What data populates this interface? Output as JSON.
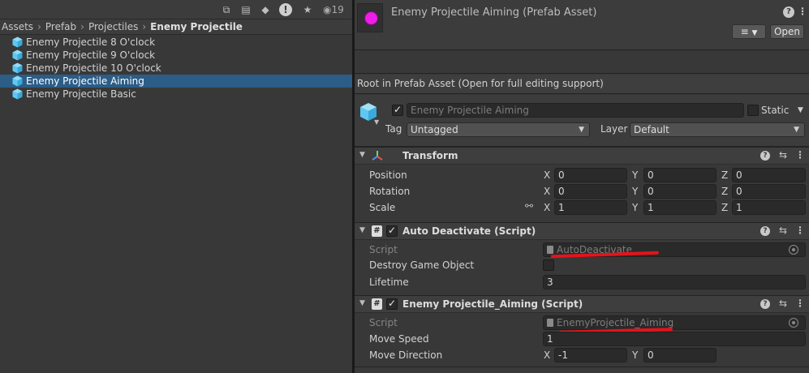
{
  "toolbar": {
    "icons": [
      "box-select-icon",
      "lock-icon",
      "tag-icon",
      "warning-icon",
      "star-icon",
      "eye-icon"
    ],
    "hidden_count": "19"
  },
  "breadcrumb": {
    "items": [
      "Assets",
      "Prefab",
      "Projectiles"
    ],
    "current": "Enemy Projectile"
  },
  "files": [
    {
      "name": "Enemy Projectile 8 O'clock"
    },
    {
      "name": "Enemy Projectile 9 O'clock"
    },
    {
      "name": "Enemy Projectile 10 O'clock"
    },
    {
      "name": "Enemy Projectile Aiming"
    },
    {
      "name": "Enemy Projectile Basic"
    }
  ],
  "selected_file_index": 3,
  "inspector": {
    "header_title": "Enemy Projectile Aiming (Prefab Asset)",
    "open_label": "Open",
    "root_notice": "Root in Prefab Asset (Open for full editing support)",
    "gameobject": {
      "name": "Enemy Projectile Aiming",
      "active": true,
      "static_label": "Static",
      "static": false,
      "tag_label": "Tag",
      "tag_value": "Untagged",
      "layer_label": "Layer",
      "layer_value": "Default"
    },
    "transform": {
      "title": "Transform",
      "position_label": "Position",
      "rotation_label": "Rotation",
      "scale_label": "Scale",
      "position": {
        "x": "0",
        "y": "0",
        "z": "0"
      },
      "rotation": {
        "x": "0",
        "y": "0",
        "z": "0"
      },
      "scale": {
        "x": "1",
        "y": "1",
        "z": "1"
      }
    },
    "auto_deactivate": {
      "title": "Auto Deactivate (Script)",
      "script_label": "Script",
      "script_value": "AutoDeactivate",
      "destroy_label": "Destroy Game Object",
      "destroy_value": false,
      "lifetime_label": "Lifetime",
      "lifetime_value": "3"
    },
    "aiming": {
      "title": "Enemy Projectile_Aiming (Script)",
      "script_label": "Script",
      "script_value": "EnemyProjectile_Aiming",
      "move_speed_label": "Move Speed",
      "move_speed_value": "1",
      "move_direction_label": "Move Direction",
      "move_direction": {
        "x": "-1",
        "y": "0"
      }
    },
    "axis_labels": {
      "x": "X",
      "y": "Y",
      "z": "Z"
    }
  },
  "colors": {
    "selection": "#2c5d87",
    "preview_sphere": "#ee1de8",
    "annotation": "#e5131b",
    "cube_icon": "#5ec8f2"
  }
}
